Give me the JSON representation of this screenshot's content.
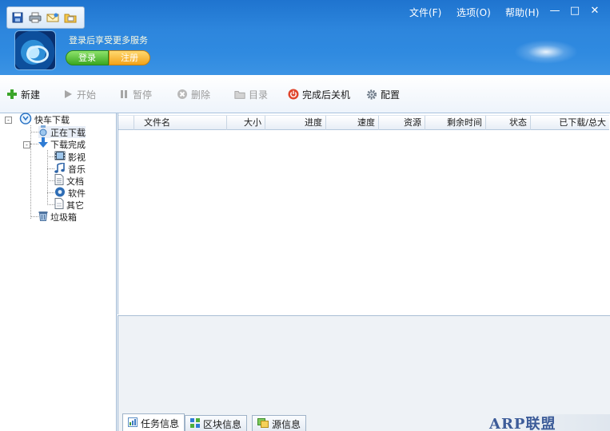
{
  "header": {
    "promo_text": "登录后享受更多服务",
    "login_label": "登录",
    "register_label": "注册",
    "menu": {
      "file": "文件(F)",
      "options": "选项(O)",
      "help": "帮助(H)"
    },
    "window_buttons": {
      "minimize": "—",
      "maximize": "□",
      "close": "✕"
    }
  },
  "quick_bar": [
    "save-icon",
    "print-icon",
    "mail-icon",
    "folder-icon"
  ],
  "toolbar": {
    "new": "新建",
    "start": "开始",
    "pause": "暂停",
    "delete": "删除",
    "directory": "目录",
    "shutdown_after": "完成后关机",
    "config": "配置"
  },
  "tree": {
    "root": "快车下载",
    "downloading": "正在下载",
    "completed": "下载完成",
    "video": "影视",
    "music": "音乐",
    "document": "文档",
    "software": "软件",
    "other": "其它",
    "trash": "垃圾箱"
  },
  "columns": [
    "文件名",
    "大小",
    "进度",
    "速度",
    "资源",
    "剩余时间",
    "状态",
    "已下载/总大"
  ],
  "bottom_tabs": [
    "任务信息",
    "区块信息",
    "源信息"
  ],
  "watermark": "ARP联盟",
  "colors": {
    "header_blue": "#2d86dd",
    "login_green": "#3aa620",
    "register_orange": "#f3a218"
  }
}
